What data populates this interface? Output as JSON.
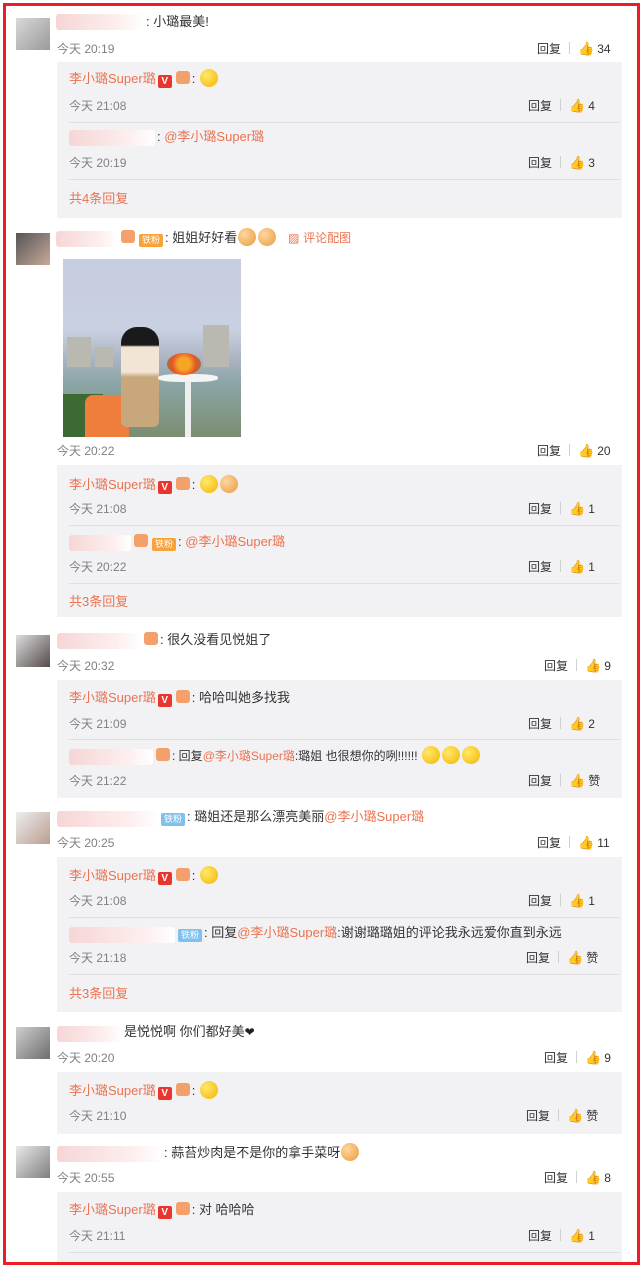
{
  "labels": {
    "reply": "回复",
    "like_word": "赞",
    "more_prefix": "共",
    "more_suffix": "条回复",
    "verified_badge": "V",
    "fan_badge": "铁粉",
    "reply_prefix": "回复"
  },
  "comments": [
    {
      "text": "小璐最美!",
      "time": "今天 20:19",
      "likes": "34",
      "replies_total": "4",
      "replies": [
        {
          "user": "李小璐Super璐",
          "text": "",
          "time": "今天 21:08",
          "likes": "4"
        },
        {
          "user": "",
          "mention": "@李小璐Super璐",
          "text": "",
          "time": "今天 20:19",
          "likes": "3"
        }
      ]
    },
    {
      "text": "姐姐好好看",
      "image_link": "评论配图",
      "time": "今天 20:22",
      "likes": "20",
      "replies_total": "3",
      "replies": [
        {
          "user": "李小璐Super璐",
          "text": "",
          "time": "今天 21:08",
          "likes": "1"
        },
        {
          "user": "",
          "mention": "@李小璐Super璐",
          "text": "",
          "time": "今天 20:22",
          "likes": "1"
        }
      ]
    },
    {
      "text": "很久没看见悦姐了",
      "time": "今天 20:32",
      "likes": "9",
      "replies": [
        {
          "user": "李小璐Super璐",
          "text": "哈哈叫她多找我",
          "time": "今天 21:09",
          "likes": "2"
        },
        {
          "user": "",
          "mention": "@李小璐Super璐",
          "text": ":璐姐  也很想你的咧!!!!!!",
          "time": "今天 21:22",
          "likes": "赞"
        }
      ]
    },
    {
      "text": "璐姐还是那么漂亮美丽",
      "mention": "@李小璐Super璐",
      "time": "今天 20:25",
      "likes": "11",
      "replies_total": "3",
      "replies": [
        {
          "user": "李小璐Super璐",
          "text": "",
          "time": "今天 21:08",
          "likes": "1"
        },
        {
          "user": "",
          "mention": "@李小璐Super璐",
          "text": ":谢谢璐璐姐的评论我永远爱你直到永远",
          "time": "今天 21:18",
          "likes": "赞"
        }
      ]
    },
    {
      "text": "是悦悦啊 你们都好美",
      "time": "今天 20:20",
      "likes": "9",
      "replies": [
        {
          "user": "李小璐Super璐",
          "text": "",
          "time": "今天 21:10",
          "likes": "赞"
        }
      ]
    },
    {
      "text": "蒜苔炒肉是不是你的拿手菜呀",
      "time": "今天 20:55",
      "likes": "8",
      "replies": [
        {
          "user": "李小璐Super璐",
          "text": "对 哈哈哈",
          "time": "今天 21:11",
          "likes": "1"
        }
      ]
    }
  ]
}
